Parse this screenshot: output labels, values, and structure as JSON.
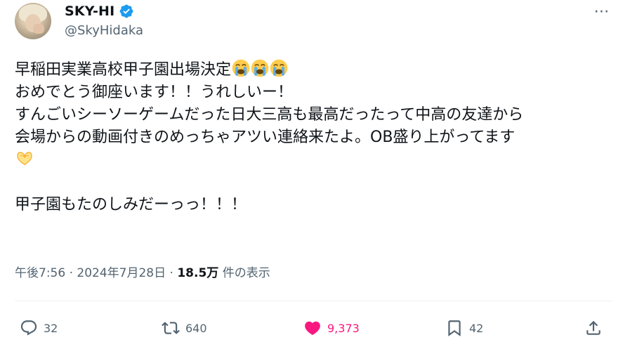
{
  "author": {
    "name": "SKY-HI",
    "handle": "@SkyHidaka",
    "verified": true
  },
  "more_icon": "⋯",
  "post": {
    "lines": [
      "早稲田実業高校甲子園出場決定",
      "おめでとう御座います！！うれしいー！",
      "すんごいシーソーゲームだった日大三高も最高だったって中高の友達から",
      "会場からの動画付きのめっちゃアツい連絡来たよ。OB盛り上がってます",
      "",
      "甲子園もたのしみだーっっ！！！"
    ],
    "emoji_line1": [
      "loudly-crying-face",
      "loudly-crying-face",
      "loudly-crying-face"
    ],
    "emoji_line4_wrap": "heart-hands"
  },
  "meta": {
    "time": "午後7:56",
    "date": "2024年7月28日",
    "separator": " · ",
    "views_count": "18.5万",
    "views_label": "件の表示"
  },
  "actions": {
    "replies": "32",
    "reposts": "640",
    "likes": "9,373",
    "bookmarks": "42"
  },
  "colors": {
    "text": "#0f1419",
    "muted": "#536471",
    "verified": "#1d9bf0",
    "like": "#f91880"
  }
}
